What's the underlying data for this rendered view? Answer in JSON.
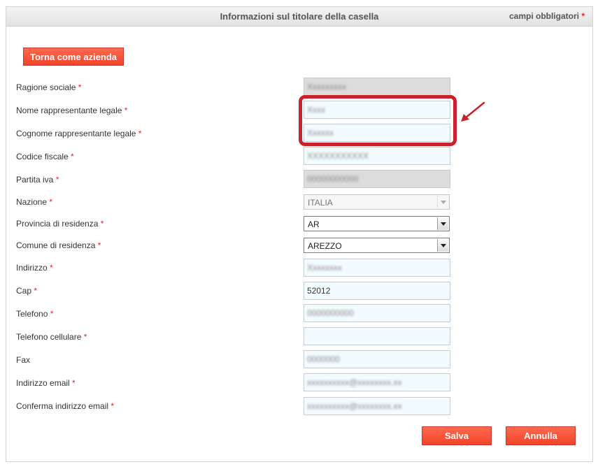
{
  "header": {
    "title": "Informazioni sul titolare della casella",
    "required_label": "campi obbligatori",
    "required_star": "*"
  },
  "back_button": "Torna come azienda",
  "form": {
    "ragione_sociale": {
      "label": "Ragione sociale",
      "star": "*",
      "value": "Xxxxxxxxx"
    },
    "nome": {
      "label": "Nome rappresentante legale",
      "star": "*",
      "value": "Xxxx"
    },
    "cognome": {
      "label": "Cognome rappresentante legale",
      "star": "*",
      "value": "Xxxxxx"
    },
    "codice_fiscale": {
      "label": "Codice fiscale",
      "star": "*",
      "value": "XXXXXXXXXXX"
    },
    "partita_iva": {
      "label": "Partita iva",
      "star": "*",
      "value": "00000000000"
    },
    "nazione": {
      "label": "Nazione",
      "star": "*",
      "value": "ITALIA"
    },
    "provincia": {
      "label": "Provincia di residenza",
      "star": "*",
      "value": "AR"
    },
    "comune": {
      "label": "Comune di residenza",
      "star": "*",
      "value": "AREZZO"
    },
    "indirizzo": {
      "label": "Indirizzo",
      "star": "*",
      "value": "Xxxxxxxx"
    },
    "cap": {
      "label": "Cap",
      "star": "*",
      "value": "52012"
    },
    "telefono": {
      "label": "Telefono",
      "star": "*",
      "value": "0000000000"
    },
    "cellulare": {
      "label": "Telefono cellulare",
      "star": "*",
      "value": ""
    },
    "fax": {
      "label": "Fax",
      "value": "0000000"
    },
    "email": {
      "label": "Indirizzo email",
      "star": "*",
      "value": "xxxxxxxxxx@xxxxxxxx.xx"
    },
    "conferma_email": {
      "label": "Conferma indirizzo email",
      "star": "*",
      "value": "xxxxxxxxxx@xxxxxxxx.xx"
    }
  },
  "buttons": {
    "save": "Salva",
    "cancel": "Annulla"
  },
  "colors": {
    "accent": "#f2442a",
    "required_star": "#e0262c",
    "annotation": "#c8232c"
  }
}
